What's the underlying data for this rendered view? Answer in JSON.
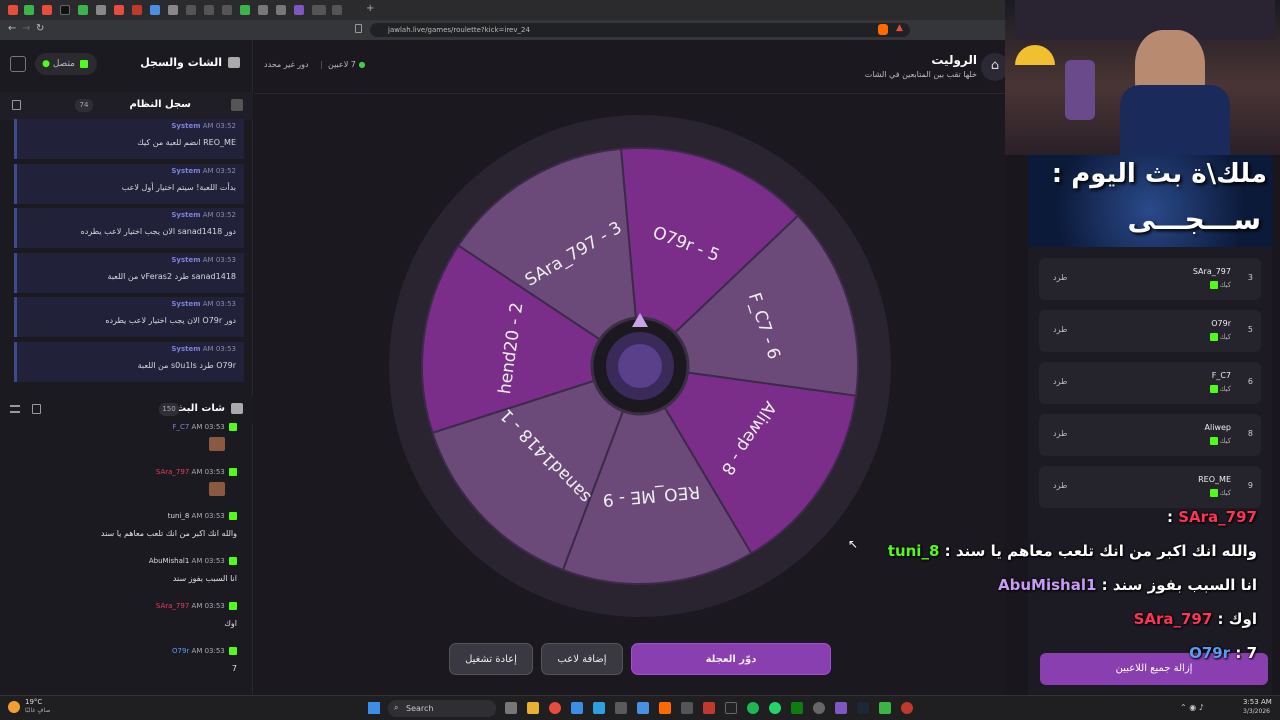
{
  "browser": {
    "url": "jawlah.live/games/roulette?kick=irev_24"
  },
  "left": {
    "title": "الشات والسجل",
    "status": "متصل",
    "system_log": {
      "title": "سجل النظام",
      "count": "74",
      "messages": [
        {
          "sender": "System",
          "time": "AM 03:52",
          "text": "REO_ME انضم للعبة من كيك"
        },
        {
          "sender": "System",
          "time": "AM 03:52",
          "text": "بدأت اللعبة! سيتم اختيار أول لاعب"
        },
        {
          "sender": "System",
          "time": "AM 03:52",
          "text": "دور sanad1418 الان يجب اختيار لاعب يطرده"
        },
        {
          "sender": "System",
          "time": "AM 03:53",
          "text": "sanad1418 طرد vFeras2 من اللعبة"
        },
        {
          "sender": "System",
          "time": "AM 03:53",
          "text": "دور O79r الان يجب اختيار لاعب يطرده"
        },
        {
          "sender": "System",
          "time": "AM 03:53",
          "text": "O79r طرد s0u1ls من اللعبة"
        }
      ]
    },
    "stream_chat": {
      "title": "شات البث",
      "count": "150",
      "messages": [
        {
          "user": "F_C7",
          "time": "AM 03:53",
          "text": "",
          "user_color": "#7b82d8"
        },
        {
          "user": "SAra_797",
          "time": "AM 03:53",
          "text": "",
          "user_color": "#e0405a"
        },
        {
          "user": "tuni_8",
          "time": "AM 03:53",
          "text": "والله انك اكبر من انك تلعب معاهم يا سند",
          "user_color": "#ddd"
        },
        {
          "user": "AbuMishal1",
          "time": "AM 03:53",
          "text": "انا السبب بفوز سند",
          "user_color": "#ddd"
        },
        {
          "user": "SAra_797",
          "time": "AM 03:53",
          "text": "اوك",
          "user_color": "#e0405a"
        },
        {
          "user": "O79r",
          "time": "AM 03:53",
          "text": "7",
          "user_color": "#5b9bf0"
        }
      ]
    }
  },
  "main": {
    "title": "الروليت",
    "subtitle": "خلها تقب بين المتابعين في الشات",
    "players_count": "7 لاعبين",
    "turn_status": "دور غير محدد",
    "wheel": {
      "segments": [
        {
          "label": "O79r - 5",
          "color": "#7a2e8a"
        },
        {
          "label": "F_C7 - 6",
          "color": "#6b4a7a"
        },
        {
          "label": "Aliwep - 8",
          "color": "#7a2e8a"
        },
        {
          "label": "REO_ME - 9",
          "color": "#6b4a7a"
        },
        {
          "label": "sanad1418 - 1",
          "color": "#6b4a7a"
        },
        {
          "label": "hend20 - 2",
          "color": "#7a2e8a"
        },
        {
          "label": "SAra_797 - 3",
          "color": "#6b4a7a"
        }
      ]
    },
    "buttons": {
      "spin": "دوّر العجلة",
      "add_player": "إضافة لاعب",
      "restart": "إعادة تشغيل"
    }
  },
  "overlay": {
    "banner_line1": "ملك\\ة بث اليوم :",
    "banner_line2": "ســـجـــى",
    "players": [
      {
        "num": "3",
        "name": "SAra_797",
        "platform": "كيك",
        "kick": "طرد"
      },
      {
        "num": "5",
        "name": "O79r",
        "platform": "كيك",
        "kick": "طرد"
      },
      {
        "num": "6",
        "name": "F_C7",
        "platform": "كيك",
        "kick": "طرد"
      },
      {
        "num": "8",
        "name": "Aliwep",
        "platform": "كيك",
        "kick": "طرد"
      },
      {
        "num": "9",
        "name": "REO_ME",
        "platform": "كيك",
        "kick": "طرد"
      }
    ],
    "remove_all": "إزالة جميع اللاعبين",
    "chat": [
      {
        "user": "SAra_797",
        "sep": ":",
        "text": "",
        "color": "#ff3355"
      },
      {
        "user": "8_tuni",
        "sep": ":",
        "text": "والله انك اكبر من انك تلعب معاهم يا سند",
        "color": "#53fc18"
      },
      {
        "user": "AbuMishal1",
        "sep": ":",
        "text": "انا السبب بفوز سند",
        "color": "#c79cf5"
      },
      {
        "user": "SAra_797",
        "sep": ":",
        "text": "اوك",
        "color": "#ff3355"
      },
      {
        "user": "O79r",
        "sep": ":",
        "text": "7",
        "color": "#5b9bf0"
      }
    ]
  },
  "taskbar": {
    "weather": "19°C",
    "weather_desc": "صافٍ غالبًا",
    "search": "Search",
    "time": "3:53 AM",
    "date": "3/3/2026"
  }
}
